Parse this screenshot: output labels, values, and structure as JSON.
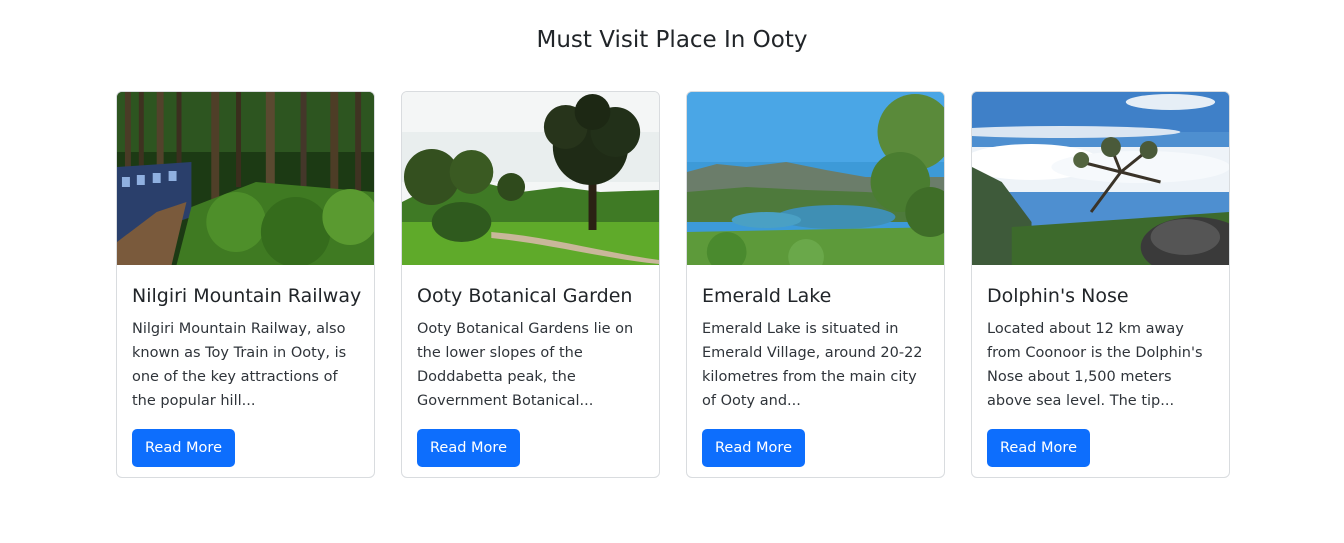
{
  "section": {
    "title": "Must Visit Place In Ooty"
  },
  "cards": [
    {
      "title": "Nilgiri Mountain Railway",
      "text": "Nilgiri Mountain Railway, also known as Toy Train in Ooty, is one of the key attractions of the popular hill...",
      "button": "Read More",
      "image": "nilgiri-railway-photo"
    },
    {
      "title": "Ooty Botanical Garden",
      "text": "Ooty Botanical Gardens lie on the lower slopes of the Doddabetta peak, the Government Botanical...",
      "button": "Read More",
      "image": "botanical-garden-photo"
    },
    {
      "title": "Emerald Lake",
      "text": "Emerald Lake is situated in Emerald Village, around 20-22 kilometres from the main city of Ooty and...",
      "button": "Read More",
      "image": "emerald-lake-photo"
    },
    {
      "title": "Dolphin's Nose",
      "text": "Located about 12 km away from Coonoor is the Dolphin's Nose about 1,500 meters above sea level. The tip...",
      "button": "Read More",
      "image": "dolphins-nose-photo"
    }
  ]
}
